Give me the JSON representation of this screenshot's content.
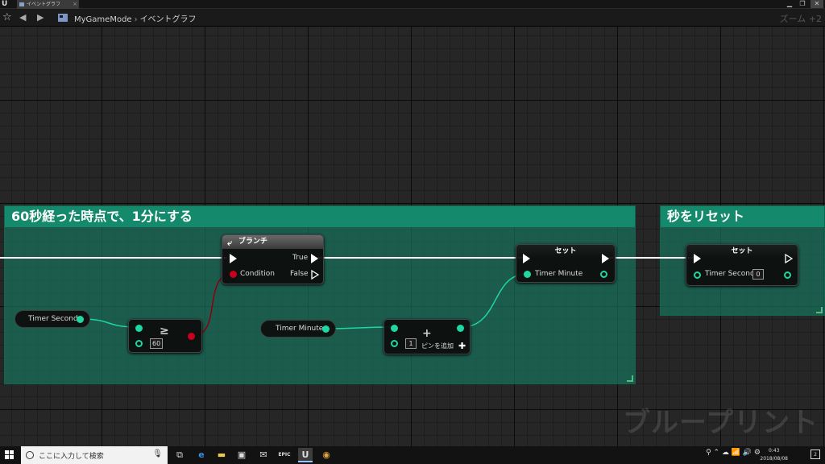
{
  "titlebar": {
    "tab_title": "イベントグラフ",
    "tab_close": "×",
    "logo": "U",
    "minimize": "▁",
    "restore": "❐",
    "close": "✕"
  },
  "toolbar": {
    "bookmark": "☆",
    "back": "◀",
    "forward": "▶",
    "breadcrumb_root": "MyGameMode",
    "breadcrumb_sep": "›",
    "breadcrumb_current": "イベントグラフ",
    "zoom": "ズーム +2"
  },
  "graph": {
    "comments": [
      {
        "title": "60秒経った時点で、1分にする"
      },
      {
        "title": "秒をリセット"
      }
    ],
    "nodes": {
      "timer_second_getter": {
        "label": "Timer Second"
      },
      "greater_equal": {
        "symbol": "≥",
        "value": "60"
      },
      "branch": {
        "title": "ブランチ",
        "icon": "⤶",
        "condition": "Condition",
        "true_label": "True",
        "false_label": "False"
      },
      "timer_minute_getter": {
        "label": "Timer Minute"
      },
      "add": {
        "symbol": "+",
        "value": "1",
        "add_pin": "ピンを追加",
        "add_pin_plus": "✚"
      },
      "set_minute": {
        "title": "セット",
        "pin_label": "Timer Minute"
      },
      "set_second": {
        "title": "セット",
        "pin_label": "Timer Second",
        "value": "0"
      }
    },
    "watermark": "ブループリント",
    "colors": {
      "exec_wire": "#ffffff",
      "int_wire": "#1fd7a0",
      "bool_wire": "#8a0012",
      "comment": "#14896c"
    }
  },
  "taskbar": {
    "search_placeholder": "ここに入力して検索",
    "apps": [
      "task-view",
      "edge",
      "file-explorer",
      "store",
      "mail",
      "epic",
      "unreal",
      "chrome"
    ],
    "app_glyphs": {
      "taskview": "⧉",
      "edge": "e",
      "explorer": "▬",
      "store": "▣",
      "mail": "✉",
      "epic": "EPIC",
      "unreal": "U",
      "chrome": "◉"
    },
    "tray": "⚲ ⌃ ☁ 📶 🔊 ⚙",
    "time": "0:43",
    "date": "2018/08/08",
    "notifications": "2"
  }
}
